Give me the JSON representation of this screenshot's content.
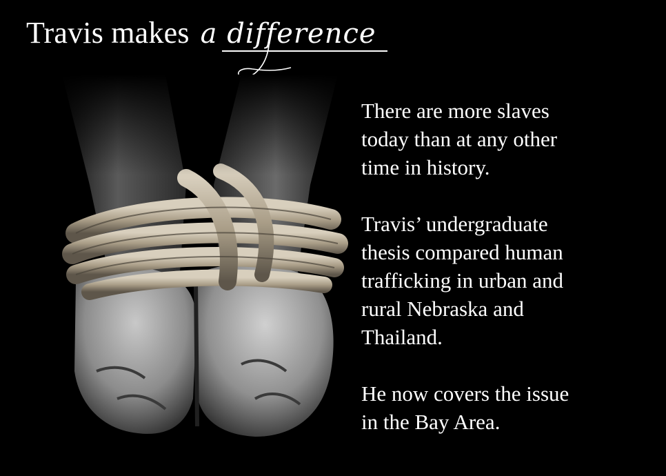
{
  "headline": {
    "main": "Travis makes",
    "script": "a difference"
  },
  "photo": {
    "subject": "hands-bound-with-rope"
  },
  "paragraphs": [
    "There are more slaves\ntoday than at any other\ntime in history.",
    "Travis’ undergraduate\nthesis compared human\ntrafficking in urban and\nrural Nebraska and\nThailand.",
    "He now covers the issue\nin the Bay Area."
  ],
  "colors": {
    "background": "#000000",
    "text": "#ffffff",
    "rope": "#b9ad98",
    "skin": "#8a8a8a"
  }
}
